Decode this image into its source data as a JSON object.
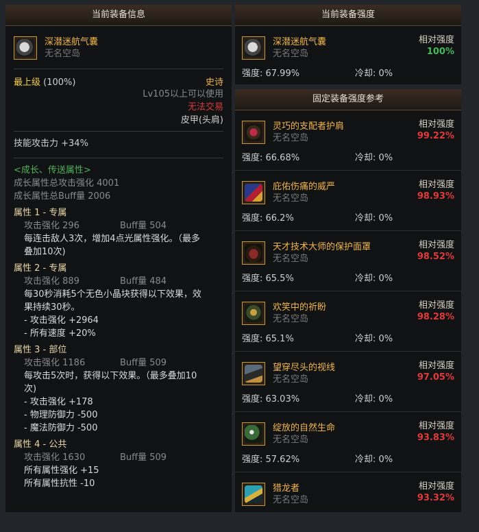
{
  "left": {
    "header": "当前装备信息",
    "item": {
      "name": "深潜迷航气囊",
      "sub": "无名空岛",
      "icon": "balloon-gear-icon"
    },
    "level_label": "最上级",
    "level_pct": "(100%)",
    "rarity": "史诗",
    "req": "Lv105以上可以使用",
    "trade": "无法交易",
    "slot": "皮甲(头肩)",
    "skill_atk": "技能攻击力   +34%",
    "growth_title": "<成长、传送属性>",
    "growth_lines": [
      "成长属性总攻击强化 4001",
      "成长属性总Buff量 2006"
    ],
    "attrs": [
      {
        "title": "属性 1 - 专属",
        "atk": "攻击强化   296",
        "buff": "Buff量   504",
        "desc": [
          "每连击敌人3次，增加4点光属性强化。（最多",
          "叠加10次)"
        ],
        "bullets": []
      },
      {
        "title": "属性 2 - 专属",
        "atk": "攻击强化   889",
        "buff": "Buff量   484",
        "desc": [
          "每30秒消耗5个无色小晶块获得以下效果，效",
          "果持续30秒。"
        ],
        "bullets": [
          "- 攻击强化 +2964",
          "- 所有速度 +20%"
        ]
      },
      {
        "title": "属性 3 - 部位",
        "atk": "攻击强化   1186",
        "buff": "Buff量   509",
        "desc": [
          "每攻击5次时，获得以下效果。（最多叠加10",
          "次)"
        ],
        "bullets": [
          "- 攻击强化 +178",
          "- 物理防御力 -500",
          "- 魔法防御力 -500"
        ]
      },
      {
        "title": "属性 4 - 公共",
        "atk": "攻击强化   1630",
        "buff": "Buff量   509",
        "desc": [
          "所有属性强化 +15",
          "所有属性抗性 -10"
        ],
        "bullets": []
      }
    ]
  },
  "current": {
    "header": "当前装备强度",
    "name": "深潜迷航气囊",
    "sub": "无名空岛",
    "rel_label": "相对强度",
    "rel_val": "100%",
    "strength": "强度: 67.99%",
    "cooldown": "冷却: 0%",
    "icon": "balloon-gear-icon"
  },
  "reference": {
    "header": "固定装备强度参考",
    "items": [
      {
        "name": "灵巧的支配者护肩",
        "sub": "无名空岛",
        "rel_label": "相对强度",
        "rel_val": "99.22%",
        "strength": "强度: 66.68%",
        "cooldown": "冷却: 0%",
        "icon": "shoulder-armor-icon"
      },
      {
        "name": "庇佑伤痛的威严",
        "sub": "无名空岛",
        "rel_label": "相对强度",
        "rel_val": "98.93%",
        "strength": "强度: 66.2%",
        "cooldown": "冷却: 0%",
        "icon": "cloak-icon"
      },
      {
        "name": "天才技术大师的保护面罩",
        "sub": "无名空岛",
        "rel_label": "相对强度",
        "rel_val": "98.52%",
        "strength": "强度: 65.5%",
        "cooldown": "冷却: 0%",
        "icon": "mask-icon"
      },
      {
        "name": "欢笑中的祈盼",
        "sub": "无名空岛",
        "rel_label": "相对强度",
        "rel_val": "98.28%",
        "strength": "强度: 65.1%",
        "cooldown": "冷却: 0%",
        "icon": "armor-icon"
      },
      {
        "name": "望穿尽头的视线",
        "sub": "无名空岛",
        "rel_label": "相对强度",
        "rel_val": "97.05%",
        "strength": "强度: 63.03%",
        "cooldown": "冷却: 0%",
        "icon": "cape-icon"
      },
      {
        "name": "绽放的自然生命",
        "sub": "无名空岛",
        "rel_label": "相对强度",
        "rel_val": "93.83%",
        "strength": "强度: 57.62%",
        "cooldown": "冷却: 0%",
        "icon": "flower-armor-icon"
      },
      {
        "name": "猎龙者",
        "sub": "无名空岛",
        "rel_label": "相对强度",
        "rel_val": "93.32%",
        "strength": "",
        "cooldown": "",
        "icon": "dragon-hunter-icon"
      }
    ]
  }
}
